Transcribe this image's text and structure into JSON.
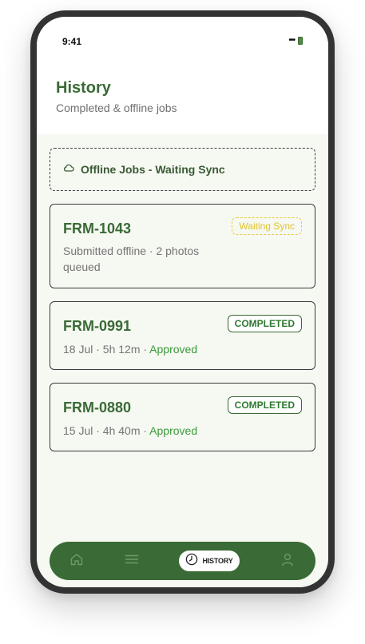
{
  "status_bar": {
    "time": "9:41",
    "signal": "•••",
    "battery_icon": "battery-icon"
  },
  "header": {
    "title": "History",
    "subtitle": "Completed & offline jobs"
  },
  "offline_section": {
    "icon": "cloud-icon",
    "label": "Offline Jobs - Waiting Sync"
  },
  "jobs": [
    {
      "id": "FRM-1043",
      "meta": "Submitted offline · 2 photos queued",
      "meta_status": "",
      "badge": "Waiting Sync"
    },
    {
      "id": "FRM-0991",
      "meta": "18 Jul · 5h 12m · ",
      "meta_status": "Approved",
      "badge": "COMPLETED"
    },
    {
      "id": "FRM-0880",
      "meta": "15 Jul · 4h 40m · ",
      "meta_status": "Approved",
      "badge": "COMPLETED"
    }
  ],
  "nav": {
    "items": [
      "home-icon",
      "menu-icon",
      "clock-icon",
      "user-icon"
    ],
    "active_label": "HISTORY"
  },
  "colors": {
    "brand_green": "#3a6a35",
    "approved_green": "#3a9a3a",
    "waiting_yellow": "#e0c42c",
    "screen_bg": "#f6f8f2"
  }
}
